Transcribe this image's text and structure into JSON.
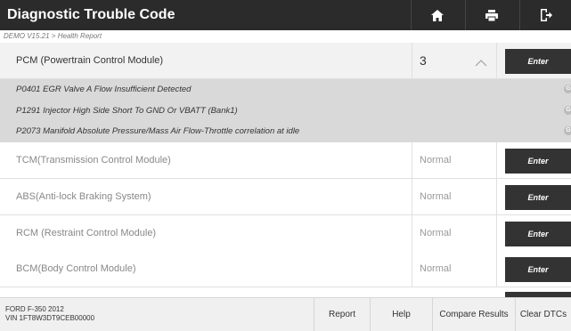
{
  "header": {
    "title": "Diagnostic Trouble Code",
    "buttons": [
      {
        "name": "home",
        "icon": "home-icon"
      },
      {
        "name": "print",
        "icon": "printer-icon"
      },
      {
        "name": "exit",
        "icon": "exit-icon"
      }
    ]
  },
  "breadcrumb": "DEMO V15.21 > Health Report",
  "modules": [
    {
      "name": "PCM (Powertrain Control Module)",
      "status": "3",
      "enter": "Enter",
      "expanded": true
    },
    {
      "name": "TCM(Transmission Control Module)",
      "status": "Normal",
      "enter": "Enter"
    },
    {
      "name": "ABS(Anti-lock Braking System)",
      "status": "Normal",
      "enter": "Enter"
    },
    {
      "name": "RCM (Restraint Control Module)",
      "status": "Normal",
      "enter": "Enter"
    },
    {
      "name": "BCM(Body Control Module)",
      "status": "Normal",
      "enter": "Enter"
    }
  ],
  "dtcs": [
    {
      "text": "P0401 EGR Valve A Flow Insufficient Detected",
      "icon": "G"
    },
    {
      "text": "P1291 Injector High Side Short To GND Or VBATT (Bank1)",
      "icon": "G"
    },
    {
      "text": "P2073 Manifold Absolute Pressure/Mass Air Flow-Throttle correlation at idle",
      "icon": "G"
    }
  ],
  "footer": {
    "vehicle_model": "FORD F-350 2012",
    "vin": "VIN 1FT8W3DT9CEB00000",
    "buttons": {
      "report": "Report",
      "help": "Help",
      "compare": "Compare Results",
      "clear": "Clear DTCs"
    }
  },
  "colors": {
    "header_bg": "#2b2b2b",
    "enter_bg": "#333333",
    "dtc_bg": "#d9d9d9",
    "footer_bg": "#f0f0f0"
  }
}
